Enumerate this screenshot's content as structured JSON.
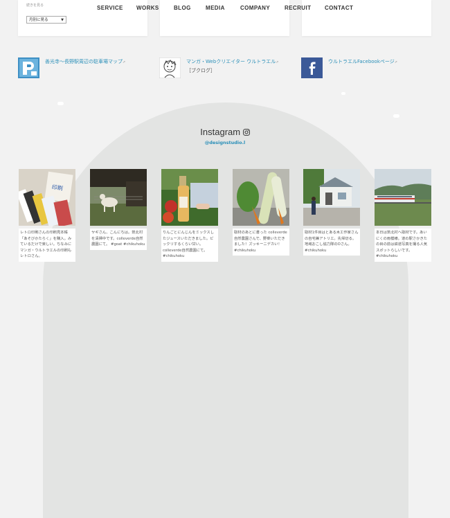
{
  "nav": [
    "SERVICE",
    "WORKS",
    "BLOG",
    "MEDIA",
    "COMPANY",
    "RECRUIT",
    "CONTACT"
  ],
  "archive": {
    "label": "続きを見る",
    "select_value": "月別に見る"
  },
  "links": [
    {
      "text": "善光寺〜長野駅周辺の駐車場マップ",
      "icon": "P-logo",
      "ext": "⇗"
    },
    {
      "text": "マンガ・Webクリエイター ウルトラエル",
      "sub": "［ブクログ］",
      "icon": "manga-sketch",
      "ext": "⇗"
    },
    {
      "text": "ウルトラエルFacebookページ",
      "icon": "facebook",
      "ext": "⇗"
    }
  ],
  "instagram": {
    "title": "Instagram",
    "handle": "@designstudio.l",
    "posts": [
      {
        "caption": "レトロ印刷さんの印刷見本帳「あそびかたらく」を購入。みているだけで楽しい。ちなみにマンガ・ウルトラエルの印刷もレトロさん。"
      },
      {
        "caption": "ヤギさん、こんにちは。筑北村を清掃中です。colleverde自然農園にて。 #goat #chikuhoku"
      },
      {
        "caption": "りんごとにんじんをミックスしたジュースいただきました。ビックリするくらい甘い。colleverde自然農園にて。 #chikuhoku"
      },
      {
        "caption": "取材のあとに書った colleverde自然農園さんで、野菜いただきました！ズッキーニデカい！ #chikuhoku"
      },
      {
        "caption": "取材1件目はとある木工作家さんの自宅兼アトリエ。先帰切る。地域おこし協力隊のOさん。 #chikuhoku"
      },
      {
        "caption": "本日は筑北村へ取材です。あいにくの雨模様。道の駅さかきたの目の前は鉄道写真を撮る人気スポットらしいです。 #chikuhoku"
      }
    ]
  },
  "colors": {
    "accent": "#2a8fb8",
    "facebook": "#3b5998",
    "arch": "#e3e4e3"
  }
}
